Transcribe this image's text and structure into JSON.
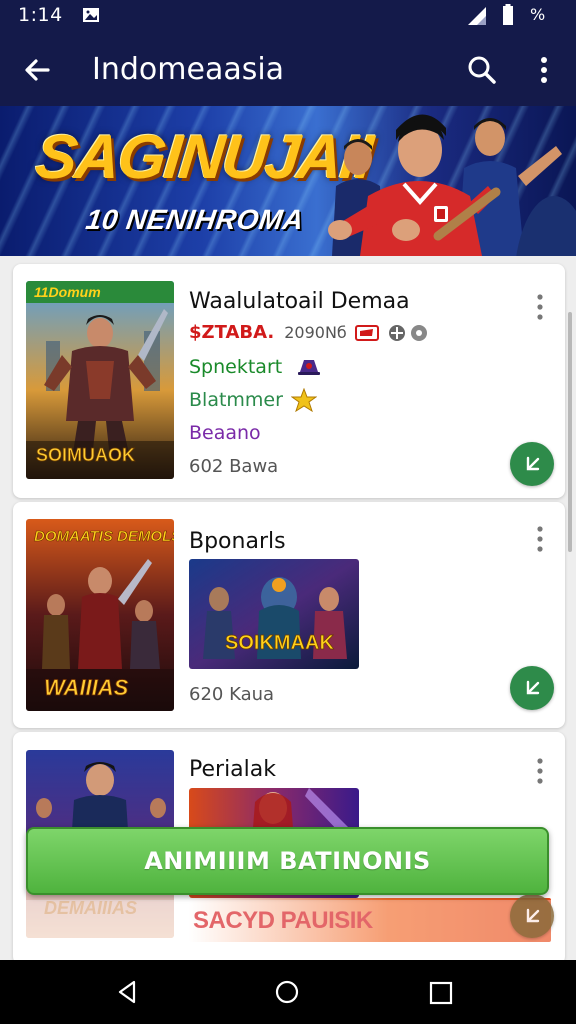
{
  "status_bar": {
    "time": "1:14",
    "battery_text": "%",
    "notification_icon": "photo-icon",
    "signal_icon": "signal-icon",
    "battery_icon": "battery-icon"
  },
  "app_bar": {
    "title": "Indomeaasia",
    "back_icon": "arrow-left-icon",
    "search_icon": "search-icon",
    "more_icon": "more-vert-icon"
  },
  "banner": {
    "title": "SAGINUJAII",
    "subtitle": "10 NENIHROMA"
  },
  "cards": [
    {
      "title": "Waalulatoail Demaa",
      "price": "$ZTABA.",
      "price_info": "2090Nб",
      "thumb_top_text": "11Domum",
      "thumb_bottom_text": "SOIMUAOK",
      "line_1": "Spnektart",
      "line_2": "Blatmmer",
      "line_3": "Beaano",
      "meta": "602 Bawa",
      "action_icon": "download-icon"
    },
    {
      "title": "Bponarls",
      "thumb_top_text": "DOMAATIS DEMOLSUK",
      "thumb_bottom_text": "WAIIIAS",
      "screenshot_text": "SOIKMAAK",
      "meta": "620 Kaua",
      "action_icon": "download-icon"
    },
    {
      "title": "Perialak",
      "thumb_bottom_text": "DEMAIIIAS",
      "promo_text": "SACYD PAUISIK",
      "action_icon": "download-icon"
    }
  ],
  "install_button": {
    "label": "ANIMIIIM BATINONIS"
  },
  "nav_bar": {
    "back_icon": "nav-back-icon",
    "home_icon": "nav-home-icon",
    "recent_icon": "nav-recent-icon"
  },
  "colors": {
    "app_bar": "#141a4a",
    "accent_green": "#4fb33e",
    "price_red": "#d11a1a",
    "fab_green": "#2e8b4a"
  }
}
